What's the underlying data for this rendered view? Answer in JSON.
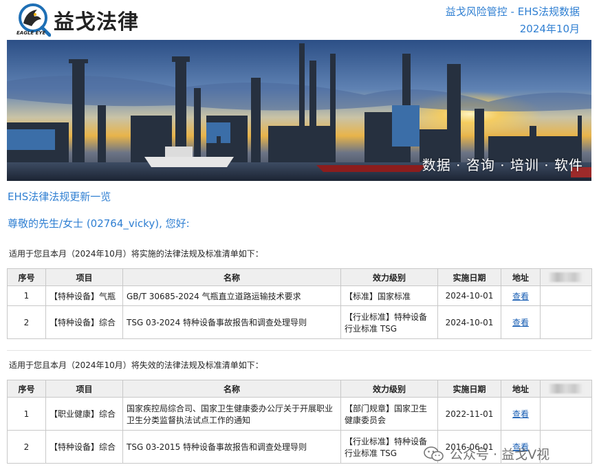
{
  "header": {
    "logo_text": "益戈法律",
    "logo_sub": "EAGLE EYE",
    "right_line1": "益戈风险管控 - EHS法规数据",
    "right_line2": "2024年10月"
  },
  "banner": {
    "caption": "数据 · 咨询 · 培训 · 软件"
  },
  "section_title": "EHS法律法规更新一览",
  "greeting": "尊敬的先生/女士 (02764_vicky), 您好:",
  "implement": {
    "intro": "适用于您且本月（2024年10月）将实施的法律法规及标准清单如下：",
    "columns": [
      "序号",
      "项目",
      "名称",
      "效力级别",
      "实施日期",
      "地址"
    ],
    "rows": [
      {
        "no": "1",
        "project": "【特种设备】气瓶",
        "name": "GB/T 30685-2024 气瓶直立道路运输技术要求",
        "level": "【标准】国家标准",
        "date": "2024-10-01",
        "link": "查看"
      },
      {
        "no": "2",
        "project": "【特种设备】综合",
        "name": "TSG 03-2024 特种设备事故报告和调查处理导则",
        "level": "【行业标准】特种设备行业标准 TSG",
        "date": "2024-10-01",
        "link": "查看"
      }
    ]
  },
  "expire": {
    "intro": "适用于您且本月（2024年10月）将失效的法律法规及标准清单如下：",
    "columns": [
      "序号",
      "项目",
      "名称",
      "效力级别",
      "实施日期",
      "地址"
    ],
    "rows": [
      {
        "no": "1",
        "project": "【职业健康】综合",
        "name": "国家疾控局综合司、国家卫生健康委办公厅关于开展职业卫生分类监督执法试点工作的通知",
        "level": "【部门规章】国家卫生健康委员会",
        "date": "2022-11-01",
        "link": "查看"
      },
      {
        "no": "2",
        "project": "【特种设备】综合",
        "name": "TSG 03-2015 特种设备事故报告和调查处理导则",
        "level": "【行业标准】特种设备行业标准 TSG",
        "date": "2016-06-01",
        "link": "查看"
      }
    ]
  },
  "watermark": "公众号 · 益戈V视",
  "colors": {
    "accent": "#2f7fd2",
    "link": "#1a5fb4",
    "header_bg": "#efefef"
  }
}
